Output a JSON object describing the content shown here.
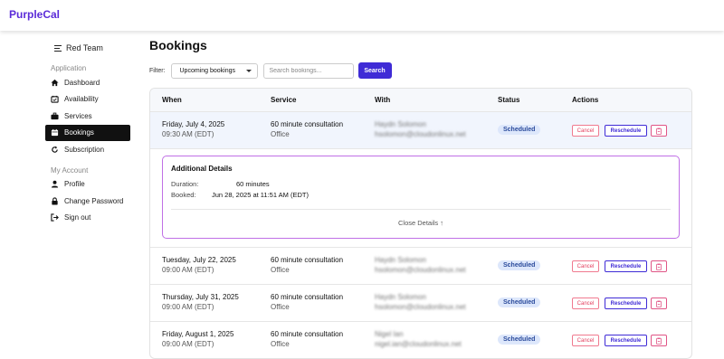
{
  "brand": "PurpleCal",
  "sidebar": {
    "team": "Red Team",
    "sections": [
      {
        "label": "Application"
      },
      {
        "label": "My Account"
      }
    ],
    "items": [
      {
        "label": "Dashboard",
        "icon": "home-icon"
      },
      {
        "label": "Availability",
        "icon": "calendar-check-icon"
      },
      {
        "label": "Services",
        "icon": "briefcase-icon"
      },
      {
        "label": "Bookings",
        "icon": "calendar-icon",
        "active": true
      },
      {
        "label": "Subscription",
        "icon": "refresh-icon"
      },
      {
        "label": "Profile",
        "icon": "user-icon"
      },
      {
        "label": "Change Password",
        "icon": "lock-icon"
      },
      {
        "label": "Sign out",
        "icon": "sign-out-icon"
      }
    ]
  },
  "page": {
    "title": "Bookings",
    "filter_label": "Filter:",
    "filter_value": "Upcoming bookings",
    "search_placeholder": "Search bookings...",
    "search_button": "Search"
  },
  "table": {
    "headers": {
      "when": "When",
      "service": "Service",
      "with": "With",
      "status": "Status",
      "actions": "Actions"
    },
    "actions": {
      "cancel": "Cancel",
      "reschedule": "Reschedule"
    },
    "rows": [
      {
        "date": "Friday, July 4, 2025",
        "time": "09:30 AM (EDT)",
        "service": "60 minute consultation",
        "location": "Office",
        "name": "Haydn Solomon",
        "email": "hsolomon@cloudonlinux.net",
        "status": "Scheduled"
      },
      {
        "date": "Tuesday, July 22, 2025",
        "time": "09:00 AM (EDT)",
        "service": "60 minute consultation",
        "location": "Office",
        "name": "Haydn Solomon",
        "email": "hsolomon@cloudonlinux.net",
        "status": "Scheduled"
      },
      {
        "date": "Thursday, July 31, 2025",
        "time": "09:00 AM (EDT)",
        "service": "60 minute consultation",
        "location": "Office",
        "name": "Haydn Solomon",
        "email": "hsolomon@cloudonlinux.net",
        "status": "Scheduled"
      },
      {
        "date": "Friday, August 1, 2025",
        "time": "09:00 AM (EDT)",
        "service": "60 minute consultation",
        "location": "Office",
        "name": "Nigel Ian",
        "email": "nigel.ian@cloudonlinux.net",
        "status": "Scheduled"
      }
    ],
    "details": {
      "title": "Additional Details",
      "duration_label": "Duration:",
      "duration_value": "60 minutes",
      "booked_label": "Booked:",
      "booked_value": "Jun 28, 2025 at 11:51 AM (EDT)",
      "close_label": "Close Details ↑"
    }
  },
  "colors": {
    "brand": "#5b2bd8",
    "primary": "#3f2bd6",
    "details_border": "#c070e6",
    "cancel": "#e33d5c",
    "badge_bg": "#dde7fb"
  }
}
